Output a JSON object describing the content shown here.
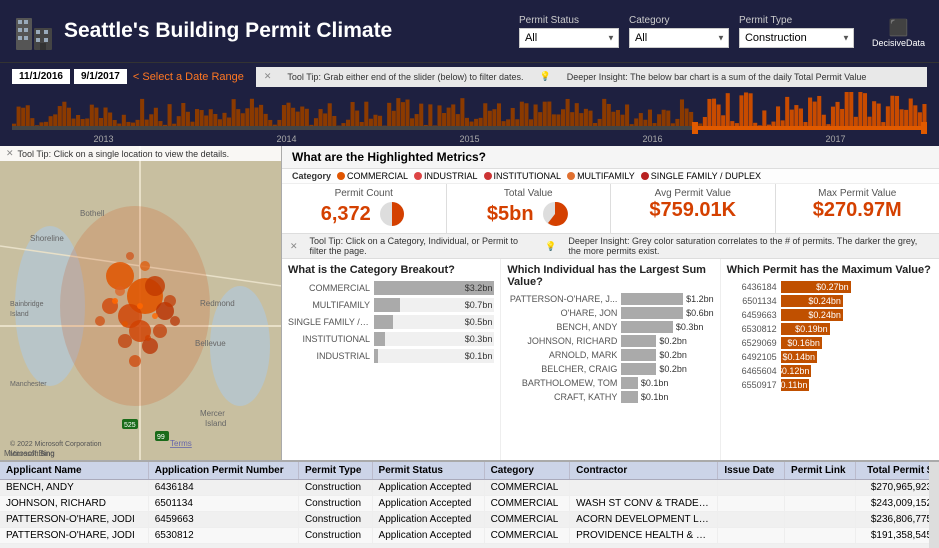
{
  "header": {
    "title": "Seattle's Building Permit Climate",
    "decisive_label": "DecisiveData"
  },
  "filters": {
    "permit_status_label": "Permit Status",
    "permit_status_value": "All",
    "category_label": "Category",
    "category_value": "All",
    "permit_type_label": "Permit Type",
    "permit_type_value": "Construction"
  },
  "date_range": {
    "start": "11/1/2016",
    "end": "9/1/2017",
    "prompt": "< Select a Date Range"
  },
  "tooltip1": "Tool Tip: Grab either end of the slider (below) to filter dates.",
  "tooltip2": "Deeper Insight: The below bar chart is a sum of the daily Total Permit Value",
  "timeline_labels": [
    "2013",
    "2014",
    "2015",
    "2016",
    "2017"
  ],
  "map_tooltip": "Tool Tip: Click on a single location to view the details.",
  "metrics_title": "What are the Highlighted Metrics?",
  "category_legend": {
    "label": "Category",
    "items": [
      {
        "name": "COMMERCIAL",
        "color": "#e05a00"
      },
      {
        "name": "INDUSTRIAL",
        "color": "#d44"
      },
      {
        "name": "INSTITUTIONAL",
        "color": "#c33"
      },
      {
        "name": "MULTIFAMILY",
        "color": "#e07030"
      },
      {
        "name": "SINGLE FAMILY / DUPLEX",
        "color": "#b22"
      }
    ]
  },
  "metrics": [
    {
      "label": "Permit Count",
      "value": "6,372",
      "pie": true
    },
    {
      "label": "Total Value",
      "value": "$5bn",
      "pie": true
    },
    {
      "label": "Avg Permit Value",
      "value": "$759.01K",
      "pie": false
    },
    {
      "label": "Max Permit Value",
      "value": "$270.97M",
      "pie": false
    }
  ],
  "chart1": {
    "title": "What is the Category Breakout?",
    "bars": [
      {
        "label": "COMMERCIAL",
        "value": "$3.2bn",
        "pct": 100
      },
      {
        "label": "MULTIFAMILY",
        "value": "$0.7bn",
        "pct": 22
      },
      {
        "label": "SINGLE FAMILY / DUP...",
        "value": "$0.5bn",
        "pct": 16
      },
      {
        "label": "INSTITUTIONAL",
        "value": "$0.3bn",
        "pct": 9
      },
      {
        "label": "INDUSTRIAL",
        "value": "$0.1bn",
        "pct": 3
      }
    ]
  },
  "chart2": {
    "title": "Which Individual has the Largest Sum Value?",
    "bars": [
      {
        "label": "PATTERSON-O'HARE, J...",
        "value": "$1.2bn",
        "pct": 100
      },
      {
        "label": "O'HARE, JON",
        "value": "$0.6bn",
        "pct": 50
      },
      {
        "label": "BENCH, ANDY",
        "value": "$0.3bn",
        "pct": 25
      },
      {
        "label": "JOHNSON, RICHARD",
        "value": "$0.2bn",
        "pct": 17
      },
      {
        "label": "ARNOLD, MARK",
        "value": "$0.2bn",
        "pct": 17
      },
      {
        "label": "BELCHER, CRAIG",
        "value": "$0.2bn",
        "pct": 17
      },
      {
        "label": "BARTHOLOMEW, TOM",
        "value": "$0.1bn",
        "pct": 8
      },
      {
        "label": "CRAFT, KATHY",
        "value": "$0.1bn",
        "pct": 8
      }
    ]
  },
  "chart3": {
    "title": "Which Permit has the Maximum Value?",
    "bars": [
      {
        "id": "6436184",
        "value": "$0.27bn",
        "pct": 100,
        "color": "#c05000"
      },
      {
        "id": "6501134",
        "value": "$0.24bn",
        "pct": 89,
        "color": "#c05000"
      },
      {
        "id": "6459663",
        "value": "$0.24bn",
        "pct": 89,
        "color": "#c05000"
      },
      {
        "id": "6530812",
        "value": "$0.19bn",
        "pct": 70,
        "color": "#c05000"
      },
      {
        "id": "6529069",
        "value": "$0.16bn",
        "pct": 59,
        "color": "#c05000"
      },
      {
        "id": "6492105",
        "value": "$0.14bn",
        "pct": 52,
        "color": "#c05000"
      },
      {
        "id": "6465604",
        "value": "$0.12bn",
        "pct": 44,
        "color": "#c05000"
      },
      {
        "id": "6550917",
        "value": "$0.11bn",
        "pct": 41,
        "color": "#c05000"
      }
    ]
  },
  "tool_tip2": "Tool Tip: Click on a Category, Individual, or Permit to filter the page.",
  "deeper_insight2": "Deeper Insight: Grey color saturation correlates to the # of permits. The darker the grey, the more permits exist.",
  "table": {
    "headers": [
      "Applicant Name",
      "Application Permit Number",
      "Permit Type",
      "Permit Status",
      "Category",
      "Contractor",
      "Issue Date",
      "Permit Link",
      "Total Permit $"
    ],
    "rows": [
      [
        "BENCH, ANDY",
        "6436184",
        "Construction",
        "Application Accepted",
        "COMMERCIAL",
        "",
        "",
        "",
        "$270,965,923"
      ],
      [
        "JOHNSON, RICHARD",
        "6501134",
        "Construction",
        "Application Accepted",
        "COMMERCIAL",
        "WASH ST CONV & TRADE CENTER",
        "",
        "",
        "$243,009,152"
      ],
      [
        "PATTERSON-O'HARE, JODI",
        "6459663",
        "Construction",
        "Application Accepted",
        "COMMERCIAL",
        "ACORN DEVELOPMENT LLC, ACORN DEVELOPM...",
        "",
        "",
        "$236,806,775"
      ],
      [
        "PATTERSON-O'HARE, JODI",
        "6530812",
        "Construction",
        "Application Accepted",
        "COMMERCIAL",
        "PROVIDENCE HEALTH & SERVICES",
        "",
        "",
        "$191,358,545"
      ]
    ]
  }
}
